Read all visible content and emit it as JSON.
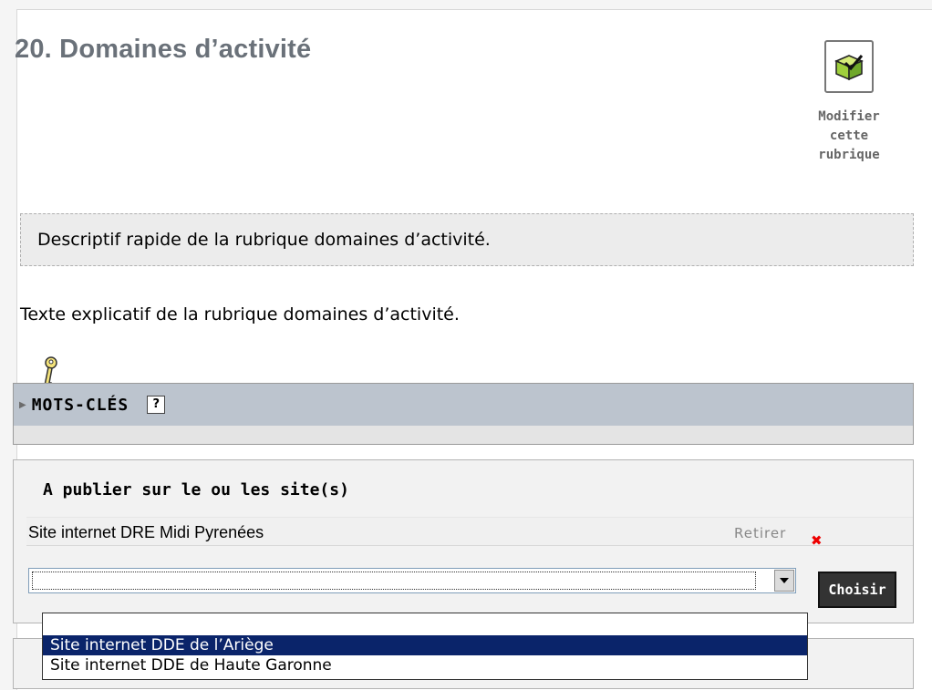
{
  "rubrique": {
    "title": "20. Domaines d’activité",
    "edit_label_lines": [
      "Modifier",
      "cette",
      "rubrique"
    ],
    "description": "Descriptif rapide de la rubrique domaines d’activité.",
    "text": "Texte explicatif de la rubrique domaines d’activité."
  },
  "keywords": {
    "label": "MOTS-CLÉS",
    "help": "?"
  },
  "publish": {
    "title": "A publier sur le ou les site(s)",
    "current_site": "Site internet DRE Midi Pyrenées",
    "remove_label": "Retirer",
    "remove_icon": "✖",
    "select_value": "",
    "choose_button": "Choisir",
    "options": [
      {
        "label": "",
        "selected": false
      },
      {
        "label": "Site internet DDE de l’Ariège",
        "selected": true
      },
      {
        "label": "Site internet DDE de Haute Garonne",
        "selected": false
      }
    ]
  },
  "colors": {
    "title": "#6a7179",
    "selection": "#0a246a",
    "remove_icon": "#ee0000"
  }
}
